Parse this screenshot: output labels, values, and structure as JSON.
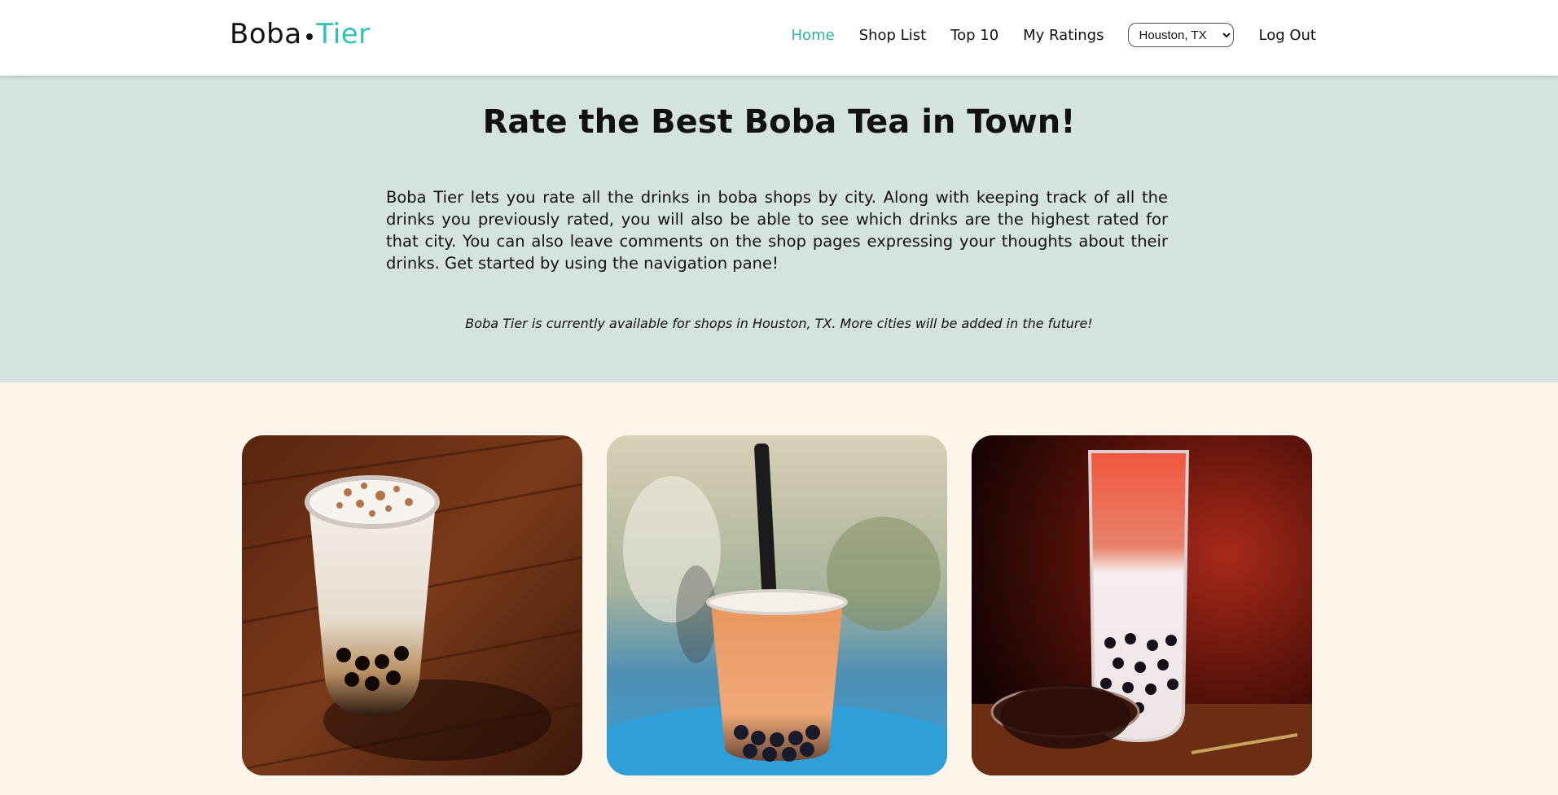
{
  "logo": {
    "part1": "Boba",
    "part2": "Tier",
    "accent_color": "#2fc4b2"
  },
  "nav": {
    "home": "Home",
    "shop_list": "Shop List",
    "top10": "Top 10",
    "my_ratings": "My Ratings",
    "city_selected": "Houston, TX",
    "logout": "Log Out"
  },
  "hero": {
    "title": "Rate the Best Boba Tea in Town!",
    "description": "Boba Tier lets you rate all the drinks in boba shops by city. Along with keeping track of all the drinks you previously rated, you will also be able to see which drinks are the highest rated for that city. You can also leave comments on the shop pages expressing your thoughts about their drinks. Get started by using the navigation pane!",
    "note": "Boba Tier is currently available for shops in Houston, TX. More cities will be added in the future!",
    "background": "#d4e3e0"
  },
  "gallery": {
    "background": "#fdf5ea"
  }
}
